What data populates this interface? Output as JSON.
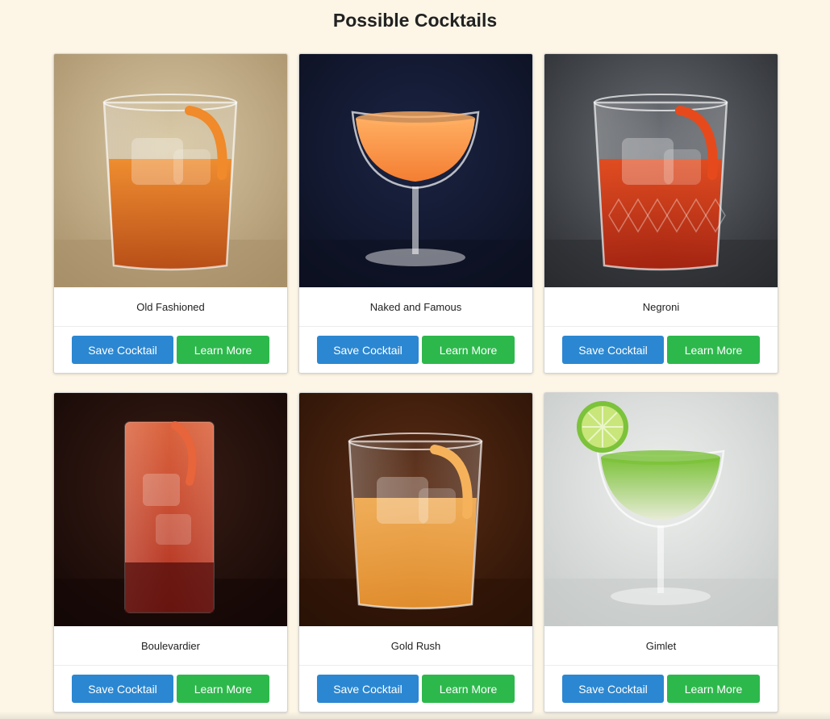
{
  "page": {
    "title": "Possible Cocktails"
  },
  "colors": {
    "background": "#fdf6e7",
    "save_button": "#2b87d1",
    "learn_button": "#2db84c"
  },
  "cocktails": [
    {
      "name": "Old Fashioned",
      "save_label": "Save Cocktail",
      "learn_label": "Learn More",
      "image": {
        "kind": "rocks",
        "background": [
          "#d8c8a4",
          "#a8906a"
        ],
        "liquid": "#b84a12",
        "accent": "#f08a2a",
        "ice": true,
        "garnish": "orange-peel"
      }
    },
    {
      "name": "Naked and Famous",
      "save_label": "Save Cocktail",
      "learn_label": "Learn More",
      "image": {
        "kind": "coupe",
        "background": [
          "#1b2444",
          "#0c1020"
        ],
        "liquid": "#f47e32",
        "accent": "#ffae62",
        "ice": false,
        "garnish": "none"
      }
    },
    {
      "name": "Negroni",
      "save_label": "Save Cocktail",
      "learn_label": "Learn More",
      "image": {
        "kind": "rocks-cut",
        "background": [
          "#6a6e74",
          "#2a2c30"
        ],
        "liquid": "#a8220e",
        "accent": "#e64a1c",
        "ice": true,
        "garnish": "orange-peel"
      }
    },
    {
      "name": "Boulevardier",
      "save_label": "Save Cocktail",
      "learn_label": "Learn More",
      "image": {
        "kind": "highball",
        "background": [
          "#3a1c14",
          "#140806"
        ],
        "liquid": "#b82a1a",
        "accent": "#e8643a",
        "ice": true,
        "garnish": "orange-peel"
      }
    },
    {
      "name": "Gold Rush",
      "save_label": "Save Cocktail",
      "learn_label": "Learn More",
      "image": {
        "kind": "rocks",
        "background": [
          "#5a2c14",
          "#2a1206"
        ],
        "liquid": "#e8922e",
        "accent": "#f6b25a",
        "ice": true,
        "garnish": "orange-peel"
      }
    },
    {
      "name": "Gimlet",
      "save_label": "Save Cocktail",
      "learn_label": "Learn More",
      "image": {
        "kind": "coupe",
        "background": [
          "#eef0ee",
          "#c6cac8"
        ],
        "liquid": "#e8ecd8",
        "accent": "#7cc23a",
        "ice": false,
        "garnish": "lime-wheel"
      }
    }
  ]
}
